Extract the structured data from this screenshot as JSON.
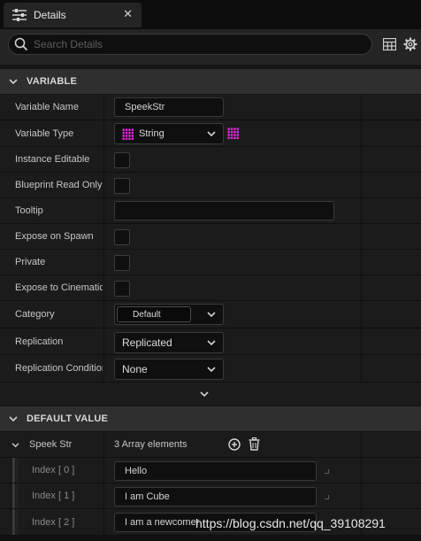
{
  "tab": {
    "title": "Details",
    "icon": "details-sliders-icon",
    "close_icon": "close-icon",
    "close": "✕"
  },
  "search": {
    "placeholder": "Search Details"
  },
  "toolbar": {
    "table_icon": "table-view-icon",
    "settings_icon": "gear-icon"
  },
  "sections": {
    "variable": {
      "title": "VARIABLE"
    },
    "default_value": {
      "title": "DEFAULT VALUE"
    }
  },
  "variable": {
    "name_label": "Variable Name",
    "name_value": "SpeekStr",
    "type_label": "Variable Type",
    "type_value": "String",
    "instance_editable_label": "Instance Editable",
    "bp_readonly_label": "Blueprint Read Only",
    "tooltip_label": "Tooltip",
    "tooltip_value": "",
    "expose_spawn_label": "Expose on Spawn",
    "private_label": "Private",
    "expose_cine_label": "Expose to Cinematics",
    "category_label": "Category",
    "category_value": "Default",
    "replication_label": "Replication",
    "replication_value": "Replicated",
    "rep_condition_label": "Replication Condition",
    "rep_condition_value": "None"
  },
  "default_value": {
    "array_label": "Speek Str",
    "array_count": "3 Array elements",
    "items": [
      {
        "index_label": "Index [ 0 ]",
        "value": "Hello"
      },
      {
        "index_label": "Index [ 1 ]",
        "value": "I am Cube"
      },
      {
        "index_label": "Index [ 2 ]",
        "value": "I am a newcomer"
      }
    ]
  },
  "watermark": "https://blog.csdn.net/qq_39108291",
  "colors": {
    "string_pin": "#e62ae0",
    "panel_bg": "#1b1b1b",
    "section_bg": "#2f2f2f"
  }
}
